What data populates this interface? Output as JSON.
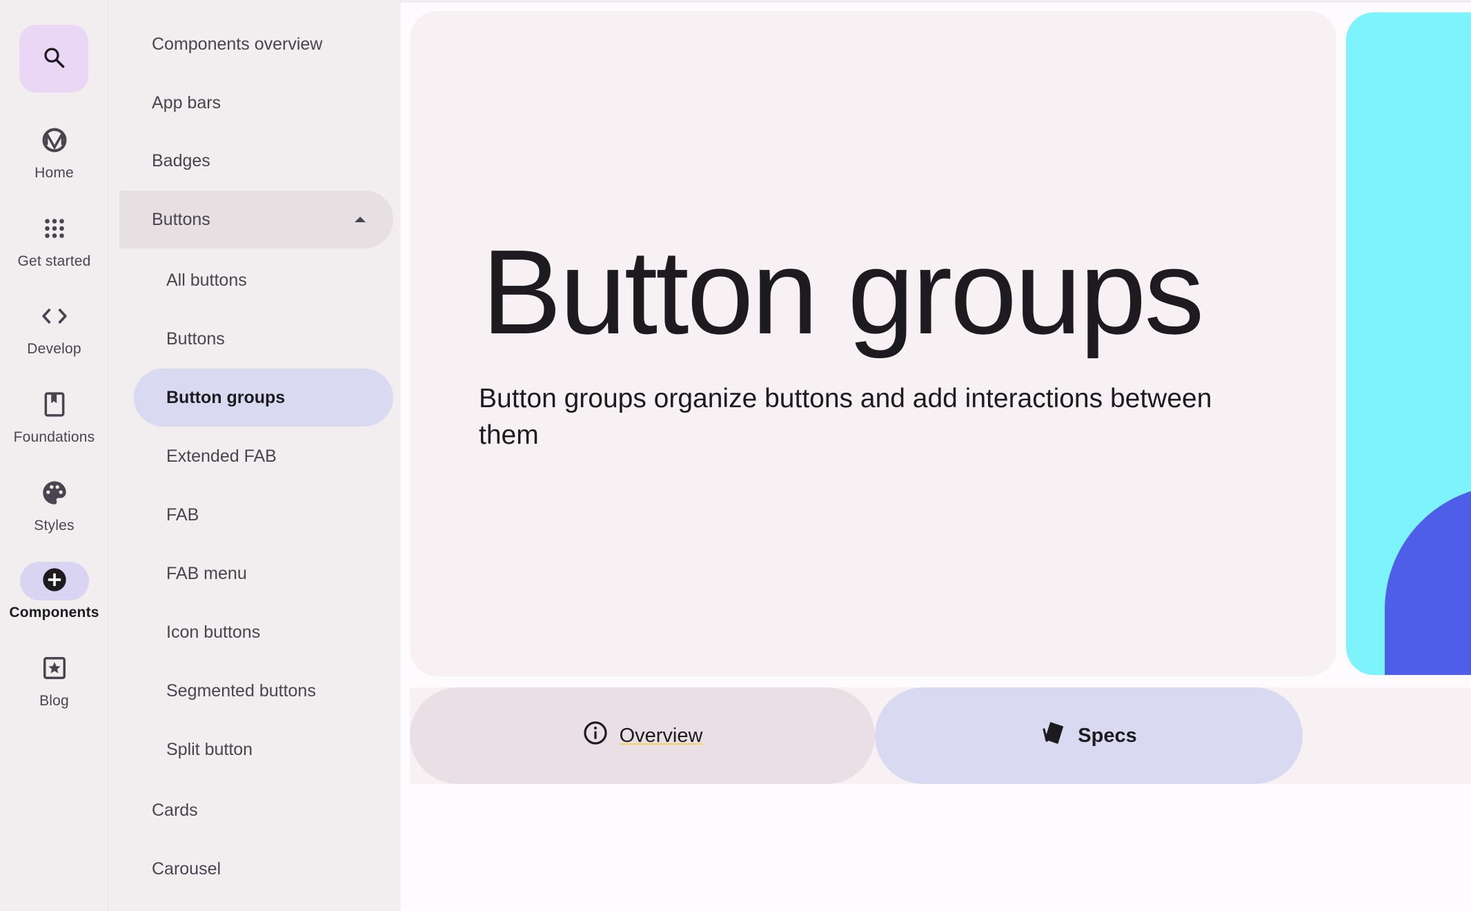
{
  "rail": {
    "search": {
      "icon": "search-icon"
    },
    "items": [
      {
        "label": "Home",
        "icon": "material-logo-icon"
      },
      {
        "label": "Get started",
        "icon": "apps-grid-icon"
      },
      {
        "label": "Develop",
        "icon": "code-icon"
      },
      {
        "label": "Foundations",
        "icon": "bookmark-icon"
      },
      {
        "label": "Styles",
        "icon": "palette-icon"
      },
      {
        "label": "Components",
        "icon": "add-circle-icon",
        "active": true
      },
      {
        "label": "Blog",
        "icon": "star-box-icon"
      }
    ]
  },
  "nav": {
    "items": [
      {
        "label": "Components overview",
        "level": "top"
      },
      {
        "label": "App bars",
        "level": "top"
      },
      {
        "label": "Badges",
        "level": "top"
      },
      {
        "label": "Buttons",
        "level": "top",
        "expanded": true
      },
      {
        "label": "All buttons",
        "level": "sub"
      },
      {
        "label": "Buttons",
        "level": "sub"
      },
      {
        "label": "Button groups",
        "level": "sub",
        "selected": true
      },
      {
        "label": "Extended FAB",
        "level": "sub"
      },
      {
        "label": "FAB",
        "level": "sub"
      },
      {
        "label": "FAB menu",
        "level": "sub"
      },
      {
        "label": "Icon buttons",
        "level": "sub"
      },
      {
        "label": "Segmented buttons",
        "level": "sub"
      },
      {
        "label": "Split button",
        "level": "sub"
      },
      {
        "label": "Cards",
        "level": "top"
      },
      {
        "label": "Carousel",
        "level": "top"
      }
    ]
  },
  "hero": {
    "title": "Button groups",
    "subtitle": "Button groups organize buttons and add interactions between them"
  },
  "tabs": {
    "overview": {
      "label": "Overview",
      "icon": "info-icon"
    },
    "specs": {
      "label": "Specs",
      "icon": "specs-icon",
      "active": true
    }
  },
  "colors": {
    "accent_container": "#dad9f2",
    "surface": "#f7f1f4",
    "rail_bg": "#f2edef",
    "search_bg": "#ead6f5",
    "art_cyan": "#7df3fb",
    "art_blue": "#4f5ee9"
  }
}
